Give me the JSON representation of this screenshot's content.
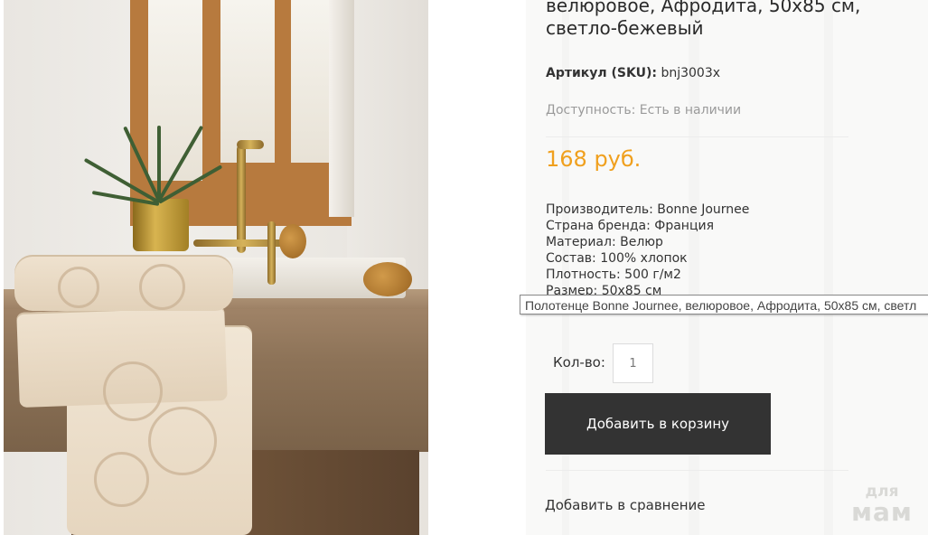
{
  "product": {
    "title": "велюровое, Афродита, 50х85 см, светло-бежевый",
    "sku_label": "Артикул (SKU):",
    "sku_value": "bnj3003x",
    "availability": "Доступность: Есть в наличии",
    "price": "168 руб.",
    "specs": [
      "Производитель: Bonne Journee",
      "Страна бренда: Франция",
      "Материал: Велюр",
      "Состав: 100% хлопок",
      "Плотность: 500 г/м2",
      "Размер: 50х85 см"
    ]
  },
  "tooltip": "Полотенце Bonne Journee, велюровое, Афродита, 50х85 см, светл",
  "cart": {
    "qty_label": "Кол-во:",
    "qty_value": "1",
    "add_button": "Добавить в корзину"
  },
  "compare_link": "Добавить в сравнение",
  "watermark": {
    "line1": "для",
    "line2": "мам"
  },
  "colors": {
    "price": "#f0a01e",
    "button_bg": "#333333",
    "panel_bg": "#f9f9f8"
  }
}
